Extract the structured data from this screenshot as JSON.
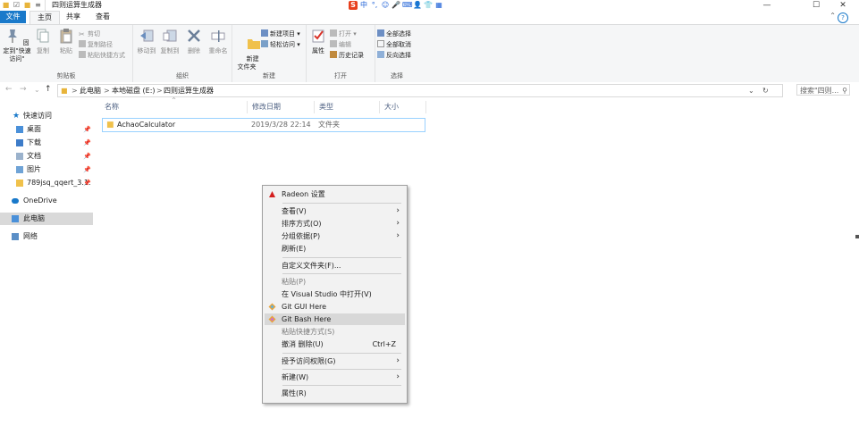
{
  "window": {
    "title": "四则运算生成器",
    "buttons": {
      "minimize": "—",
      "maximize": "☐",
      "close": "✕"
    }
  },
  "ime": {
    "logo": "S",
    "lang": "中",
    "punct": "°,",
    "emoji": "☺",
    "voice": "🎤",
    "keyboard": "⌨",
    "skin": "👤",
    "shirt": "👕",
    "grid": "▦"
  },
  "ribbon_tabs": [
    "文件",
    "主页",
    "共享",
    "查看"
  ],
  "ribbon": {
    "clipboard": {
      "label": "剪贴板",
      "pin": "固定到\"快速访问\"",
      "copy": "复制",
      "paste": "粘贴",
      "cut": "剪切",
      "copy_path": "复制路径",
      "paste_shortcut": "粘贴快捷方式"
    },
    "organize": {
      "label": "组织",
      "move_to": "移动到",
      "copy_to": "复制到",
      "delete": "删除",
      "rename": "重命名"
    },
    "new": {
      "label": "新建",
      "new_folder": "新建\n文件夹",
      "new_item": "新建项目 ▾",
      "easy_access": "轻松访问 ▾"
    },
    "open": {
      "label": "打开",
      "properties": "属性",
      "open": "打开 ▾",
      "edit": "编辑",
      "history": "历史记录"
    },
    "select": {
      "label": "选择",
      "select_all": "全部选择",
      "select_none": "全部取消",
      "invert": "反向选择"
    }
  },
  "address": {
    "path": [
      "此电脑",
      "本地磁盘 (E:)",
      "四则运算生成器"
    ],
    "sep": ">",
    "search_placeholder": "搜索\"四则...",
    "back": "←",
    "forward": "→",
    "recent": "⌄",
    "up": "↑",
    "dropdown": "⌄",
    "refresh": "↻",
    "search_icon": "⚲"
  },
  "nav": {
    "quick_access": "快速访问",
    "items": [
      {
        "label": "桌面",
        "pinned": true
      },
      {
        "label": "下载",
        "pinned": true
      },
      {
        "label": "文档",
        "pinned": true
      },
      {
        "label": "图片",
        "pinned": true
      },
      {
        "label": "789jsq_qqert_3.1.",
        "pinned": true
      }
    ],
    "pin_glyph": "📌",
    "onedrive": "OneDrive",
    "this_pc": "此电脑",
    "network": "网络"
  },
  "columns": [
    "名称",
    "修改日期",
    "类型",
    "大小"
  ],
  "files": [
    {
      "name": "AchaoCalculator",
      "date": "2019/3/28 22:14",
      "type": "文件夹",
      "size": ""
    }
  ],
  "context_menu": {
    "radeon": "Radeon 设置",
    "view": "查看(V)",
    "sort": "排序方式(O)",
    "group": "分组依据(P)",
    "refresh": "刷新(E)",
    "customize": "自定义文件夹(F)...",
    "paste": "粘贴(P)",
    "open_vs": "在 Visual Studio 中打开(V)",
    "git_gui": "Git GUI Here",
    "git_bash": "Git Bash Here",
    "paste_shortcut": "粘贴快捷方式(S)",
    "undo": "撤消 删除(U)",
    "undo_shortcut": "Ctrl+Z",
    "grant_access": "授予访问权限(G)",
    "new": "新建(W)",
    "properties": "属性(R)",
    "arrow": "›"
  },
  "colors": {
    "accent": "#1979ca",
    "selection": "#cce8ff",
    "folder": "#f0c14b"
  }
}
